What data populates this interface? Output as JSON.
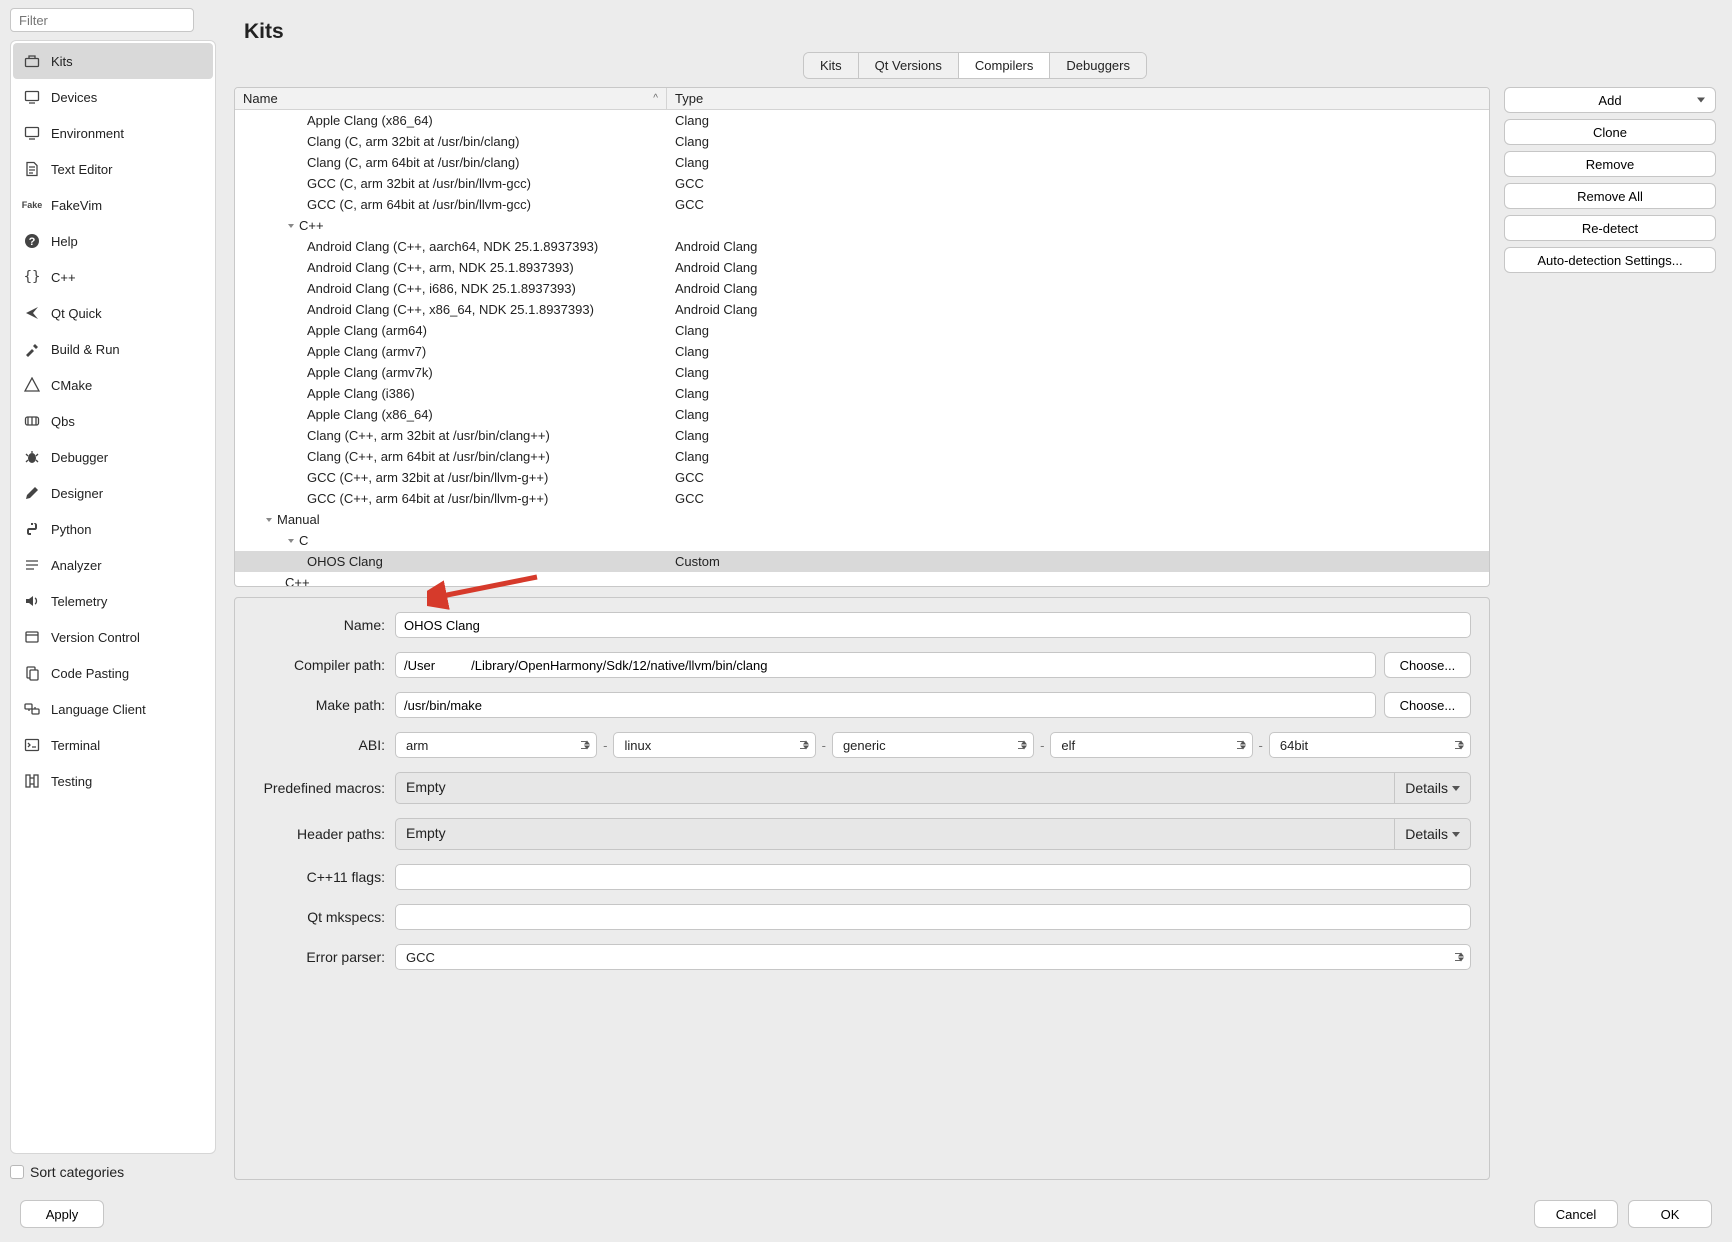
{
  "filter": {
    "placeholder": "Filter"
  },
  "page_title": "Kits",
  "sidebar": {
    "items": [
      {
        "label": "Kits",
        "icon": "toolbox"
      },
      {
        "label": "Devices",
        "icon": "monitor"
      },
      {
        "label": "Environment",
        "icon": "monitor"
      },
      {
        "label": "Text Editor",
        "icon": "doc"
      },
      {
        "label": "FakeVim",
        "icon": "fakevim"
      },
      {
        "label": "Help",
        "icon": "help"
      },
      {
        "label": "C++",
        "icon": "braces"
      },
      {
        "label": "Qt Quick",
        "icon": "arrow"
      },
      {
        "label": "Build & Run",
        "icon": "hammer"
      },
      {
        "label": "CMake",
        "icon": "cmake"
      },
      {
        "label": "Qbs",
        "icon": "hash"
      },
      {
        "label": "Debugger",
        "icon": "bug"
      },
      {
        "label": "Designer",
        "icon": "pencil"
      },
      {
        "label": "Python",
        "icon": "python"
      },
      {
        "label": "Analyzer",
        "icon": "lines"
      },
      {
        "label": "Telemetry",
        "icon": "speaker"
      },
      {
        "label": "Version Control",
        "icon": "box"
      },
      {
        "label": "Code Pasting",
        "icon": "paste"
      },
      {
        "label": "Language Client",
        "icon": "langclient"
      },
      {
        "label": "Terminal",
        "icon": "terminal"
      },
      {
        "label": "Testing",
        "icon": "testing"
      }
    ],
    "sort_label": "Sort categories"
  },
  "tabs": [
    {
      "label": "Kits"
    },
    {
      "label": "Qt Versions"
    },
    {
      "label": "Compilers",
      "active": true
    },
    {
      "label": "Debuggers"
    }
  ],
  "tree": {
    "columns": {
      "name": "Name",
      "type": "Type"
    },
    "rows": [
      {
        "depth": 3,
        "name": "Apple Clang (x86_64)",
        "type": "Clang"
      },
      {
        "depth": 3,
        "name": "Clang (C, arm 32bit at /usr/bin/clang)",
        "type": "Clang"
      },
      {
        "depth": 3,
        "name": "Clang (C, arm 64bit at /usr/bin/clang)",
        "type": "Clang"
      },
      {
        "depth": 3,
        "name": "GCC (C, arm 32bit at /usr/bin/llvm-gcc)",
        "type": "GCC"
      },
      {
        "depth": 3,
        "name": "GCC (C, arm 64bit at /usr/bin/llvm-gcc)",
        "type": "GCC"
      },
      {
        "depth": 2,
        "name": "C++",
        "type": "",
        "expand": true
      },
      {
        "depth": 3,
        "name": "Android Clang (C++, aarch64, NDK 25.1.8937393)",
        "type": "Android Clang"
      },
      {
        "depth": 3,
        "name": "Android Clang (C++, arm, NDK 25.1.8937393)",
        "type": "Android Clang"
      },
      {
        "depth": 3,
        "name": "Android Clang (C++, i686, NDK 25.1.8937393)",
        "type": "Android Clang"
      },
      {
        "depth": 3,
        "name": "Android Clang (C++, x86_64, NDK 25.1.8937393)",
        "type": "Android Clang"
      },
      {
        "depth": 3,
        "name": "Apple Clang (arm64)",
        "type": "Clang"
      },
      {
        "depth": 3,
        "name": "Apple Clang (armv7)",
        "type": "Clang"
      },
      {
        "depth": 3,
        "name": "Apple Clang (armv7k)",
        "type": "Clang"
      },
      {
        "depth": 3,
        "name": "Apple Clang (i386)",
        "type": "Clang"
      },
      {
        "depth": 3,
        "name": "Apple Clang (x86_64)",
        "type": "Clang"
      },
      {
        "depth": 3,
        "name": "Clang (C++, arm 32bit at /usr/bin/clang++)",
        "type": "Clang"
      },
      {
        "depth": 3,
        "name": "Clang (C++, arm 64bit at /usr/bin/clang++)",
        "type": "Clang"
      },
      {
        "depth": 3,
        "name": "GCC (C++, arm 32bit at /usr/bin/llvm-g++)",
        "type": "GCC"
      },
      {
        "depth": 3,
        "name": "GCC (C++, arm 64bit at /usr/bin/llvm-g++)",
        "type": "GCC"
      },
      {
        "depth": 1,
        "name": "Manual",
        "type": "",
        "expand": true
      },
      {
        "depth": 2,
        "name": "C",
        "type": "",
        "expand": true
      },
      {
        "depth": 3,
        "name": "OHOS Clang",
        "type": "Custom",
        "selected": true
      },
      {
        "depth": 2,
        "name": "C++",
        "type": ""
      }
    ]
  },
  "actions": {
    "add": "Add",
    "clone": "Clone",
    "remove": "Remove",
    "remove_all": "Remove All",
    "redetect": "Re-detect",
    "autodetect": "Auto-detection Settings..."
  },
  "form": {
    "name_label": "Name:",
    "name_value": "OHOS Clang",
    "compiler_label": "Compiler path:",
    "compiler_value": "/User          /Library/OpenHarmony/Sdk/12/native/llvm/bin/clang",
    "choose": "Choose...",
    "make_label": "Make path:",
    "make_value": "/usr/bin/make",
    "abi_label": "ABI:",
    "abi": [
      "arm",
      "linux",
      "generic",
      "elf",
      "64bit"
    ],
    "macros_label": "Predefined macros:",
    "macros_value": "Empty",
    "details": "Details",
    "headers_label": "Header paths:",
    "headers_value": "Empty",
    "cxx11_label": "C++11 flags:",
    "cxx11_value": "",
    "mkspecs_label": "Qt mkspecs:",
    "mkspecs_value": "",
    "errparser_label": "Error parser:",
    "errparser_value": "GCC"
  },
  "footer": {
    "apply": "Apply",
    "cancel": "Cancel",
    "ok": "OK"
  }
}
